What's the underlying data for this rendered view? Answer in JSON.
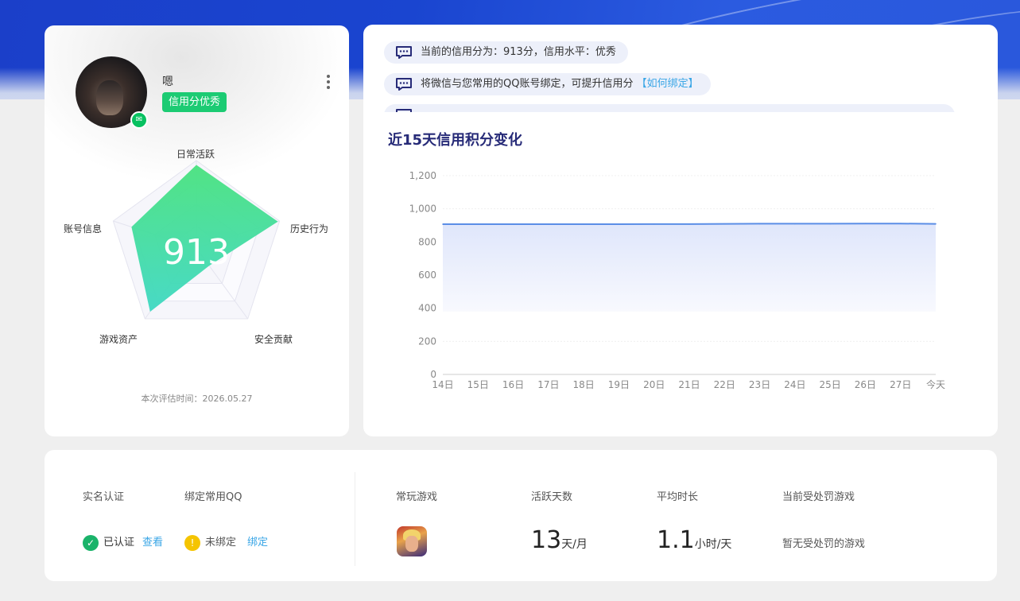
{
  "profile": {
    "nickname": "嗯",
    "credit_badge": "信用分优秀",
    "score": "913",
    "radar": {
      "labels": [
        "日常活跃",
        "历史行为",
        "安全贡献",
        "游戏资产",
        "账号信息"
      ],
      "values": [
        0.95,
        0.98,
        0.25,
        0.9,
        0.78
      ]
    },
    "eval_time": "本次评估时间：2026.05.27"
  },
  "notices": [
    {
      "text": "当前的信用分为：913分，信用水平：优秀",
      "link": ""
    },
    {
      "text": "将微信与您常用的QQ账号绑定，可提升信用分",
      "link": "【如何绑定】"
    }
  ],
  "chart_title": "近15天信用积分变化",
  "chart_data": {
    "type": "area",
    "title": "近15天信用积分变化",
    "categories": [
      "14日",
      "15日",
      "16日",
      "17日",
      "18日",
      "19日",
      "20日",
      "21日",
      "22日",
      "23日",
      "24日",
      "25日",
      "26日",
      "27日",
      "今天"
    ],
    "values": [
      907,
      907,
      907,
      907,
      907,
      907,
      908,
      908,
      909,
      910,
      910,
      910,
      911,
      911,
      909
    ],
    "ylim": [
      0,
      1200
    ],
    "yticks": [
      "0",
      "200",
      "400",
      "600",
      "800",
      "1,000",
      "1,200"
    ],
    "grid": true,
    "color": "#5b8ee6"
  },
  "bottom": {
    "realname_label": "实名认证",
    "realname_status": "已认证",
    "realname_link": "查看",
    "qq_label": "绑定常用QQ",
    "qq_status": "未绑定",
    "qq_link": "绑定",
    "games_label": "常玩游戏",
    "active_days_label": "活跃天数",
    "active_days_value": "13",
    "active_days_unit": "天/月",
    "avg_time_label": "平均时长",
    "avg_time_value": "1.1",
    "avg_time_unit": "小时/天",
    "punish_label": "当前受处罚游戏",
    "punish_value": "暂无受处罚的游戏"
  },
  "colors": {
    "accent_green": "#1ccb73",
    "link_blue": "#3aa6e6",
    "title_navy": "#272b78",
    "warn_yellow": "#f5c400"
  }
}
